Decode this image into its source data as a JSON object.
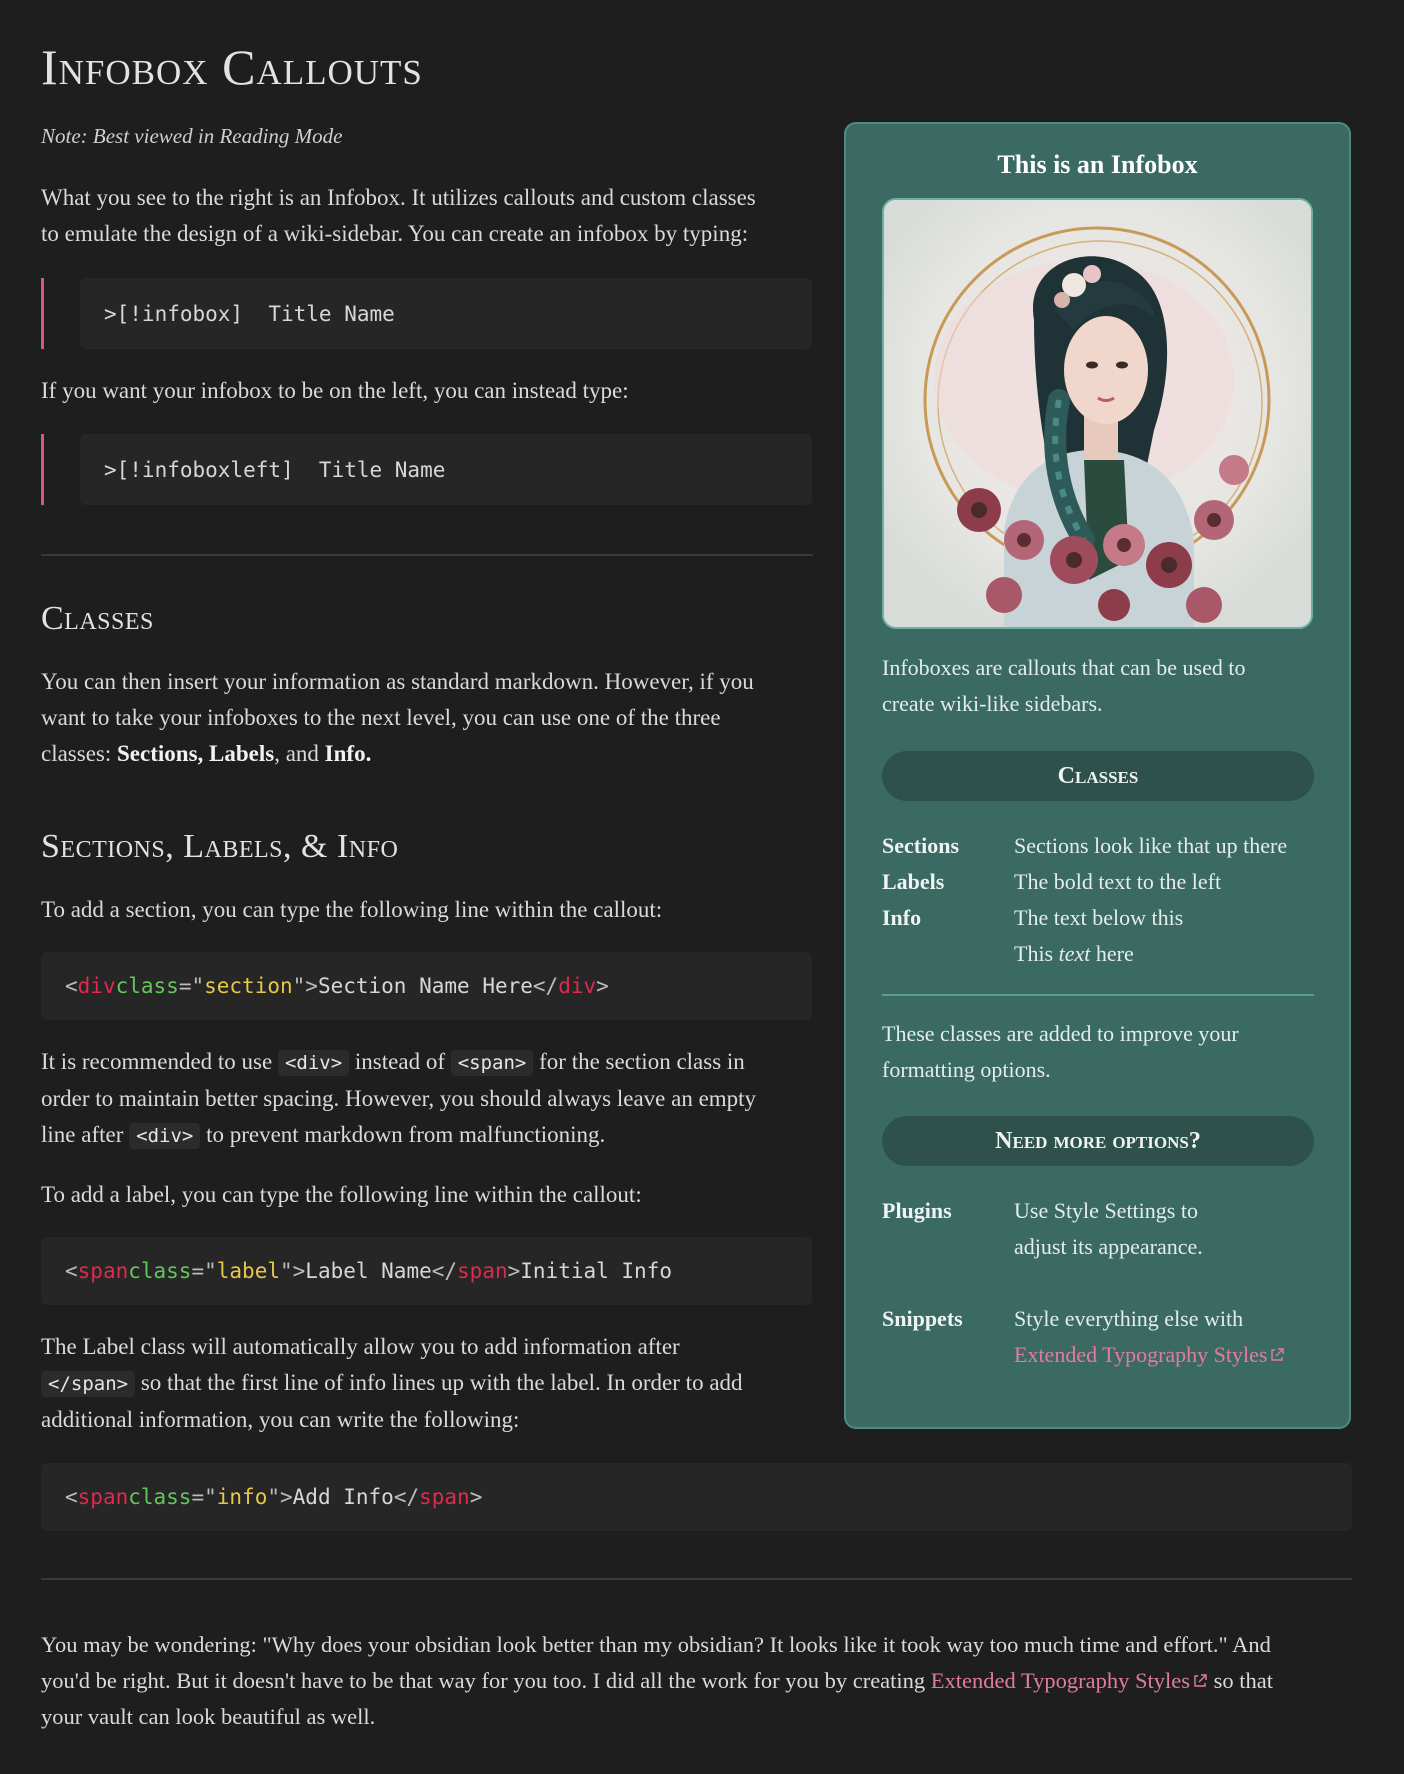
{
  "title": "Infobox Callouts",
  "note": "Note: Best viewed in Reading Mode",
  "intro": {
    "line1": "What you see to the right is an Infobox. It utilizes callouts and custom classes",
    "line2": "to emulate the design of a wiki-sidebar. You can create an infobox by typing:"
  },
  "code_infobox": ">[!infobox]  Title Name",
  "left_intro": "If you want your infobox to be on the left, you can instead type:",
  "code_infoboxleft": ">[!infoboxleft]  Title Name",
  "classes": {
    "heading": "Classes",
    "line1": "You can then insert your information as standard markdown. However, if you",
    "line2": "want to take your infoboxes to the next level, you can use one of the three",
    "line3_prefix": "classes: ",
    "bold1": "Sections",
    "sep1": ", ",
    "bold2": "Labels",
    "sep2": ", and ",
    "bold3": "Info",
    "line3_suffix": "."
  },
  "sli": {
    "heading": "Sections, Labels, & Info",
    "section_intro": "To add a section, you can type the following line within the callout:",
    "code_section": {
      "lt": "<",
      "tag": "div",
      "attr": "class",
      "eq": "=",
      "q1": "\"",
      "val": "section",
      "q2": "\"",
      "gt": ">",
      "text": "Section Name Here",
      "close_lt": "</",
      "close_tag": "div",
      "close_gt": ">"
    },
    "rec": {
      "p1": "It is recommended to use ",
      "c1": "<div>",
      "p2": " instead of ",
      "c2": "<span>",
      "p3": " for the section class in",
      "line2": "order to maintain better spacing. However, you should always leave an empty",
      "p4": "line after ",
      "c3": "<div>",
      "p5": " to prevent markdown from malfunctioning."
    },
    "label_intro": "To add a label, you can type the following line within the callout:",
    "code_label": {
      "lt": "<",
      "tag": "span",
      "attr": "class",
      "eq": "=",
      "q1": "\"",
      "val": "label",
      "q2": "\"",
      "gt": ">",
      "text": "Label Name",
      "close_lt": "</",
      "close_tag": "span",
      "close_gt": ">",
      "after": "Initial Info"
    },
    "label_desc": {
      "line1": "The Label class will automatically allow you to add information after",
      "c1": "</span>",
      "p1": " so that the first line of info lines up with the label. In order to add",
      "line3": "additional information, you can write the following:"
    },
    "code_info": {
      "lt": "<",
      "tag": "span",
      "attr": "class",
      "eq": "=",
      "q1": "\"",
      "val": "info",
      "q2": "\"",
      "gt": ">",
      "text": "Add Info",
      "close_lt": "</",
      "close_tag": "span",
      "close_gt": ">"
    }
  },
  "footer": {
    "line1": "You may be wondering: \"Why does your obsidian look better than my obsidian? It looks like it took way too much time and effort.\" And",
    "line2_prefix": "you'd be right. But it doesn't have to be that way for you too. I did all the work for you by creating ",
    "link": "Extended Typography Styles",
    "line2_suffix": " so that",
    "line3": "your vault can look beautiful as well."
  },
  "infobox": {
    "title": "This is an Infobox",
    "image_alt": "Illustrated portrait of a girl with a braid surrounded by flowers",
    "desc_line1": "Infoboxes are callouts that can be used to",
    "desc_line2": "create wiki-like sidebars.",
    "section1": "Classes",
    "rows1": [
      {
        "label": "Sections",
        "info": "Sections look like that up there"
      },
      {
        "label": "Labels",
        "info": "The bold text to the left"
      },
      {
        "label": "Info",
        "info": "The text below this"
      }
    ],
    "extra_prefix": "This ",
    "extra_em": "text",
    "extra_suffix": " here",
    "desc2_line1": "These classes are added to improve your",
    "desc2_line2": "formatting options.",
    "section2": "Need more options?",
    "plugins_label": "Plugins",
    "plugins_line1": "Use Style Settings to",
    "plugins_line2": "adjust its appearance.",
    "snippets_label": "Snippets",
    "snippets_line1": "Style everything else with",
    "snippets_link": "Extended Typography Styles"
  },
  "colors": {
    "background": "#1e1e1e",
    "infobox_bg": "#3b6a63",
    "accent_pink": "#d4597a",
    "link": "#e37c9c"
  }
}
